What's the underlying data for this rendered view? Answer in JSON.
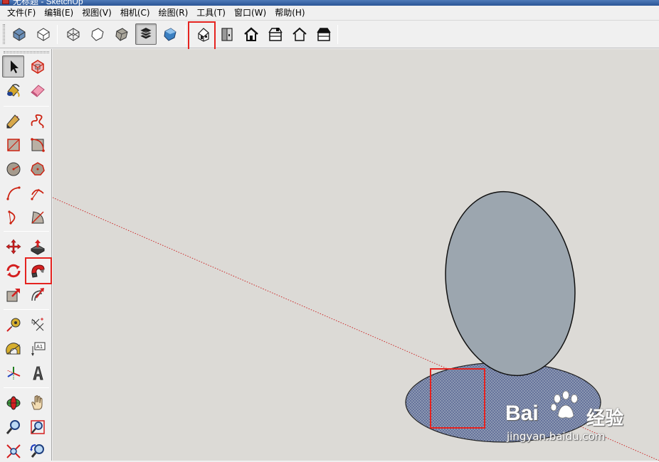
{
  "window": {
    "title": "无标题 - SketchUp"
  },
  "menubar": {
    "items": [
      "文件(F)",
      "编辑(E)",
      "视图(V)",
      "相机(C)",
      "绘图(R)",
      "工具(T)",
      "窗口(W)",
      "帮助(H)"
    ]
  },
  "toolbar": {
    "buttons": [
      "views-top-icon",
      "views-iso-icon",
      "style-xray-icon",
      "style-wireframe-icon",
      "style-hidden-line-icon",
      "style-shaded-icon",
      "style-shaded-textures-icon",
      "view-iso-house-icon",
      "view-top-house-icon",
      "view-front-house-icon",
      "view-right-house-icon",
      "view-back-house-icon",
      "view-left-house-icon"
    ],
    "highlighted": "view-iso-house-icon"
  },
  "left_toolbar": {
    "tools": [
      "select-icon",
      "make-component-icon",
      "paint-bucket-icon",
      "eraser-icon",
      "pencil-line-icon",
      "freehand-icon",
      "rectangle-icon",
      "rotated-rectangle-icon",
      "circle-icon",
      "polygon-icon",
      "arc-icon",
      "two-point-arc-icon",
      "three-point-arc-icon",
      "pie-icon",
      "move-icon",
      "push-pull-icon",
      "rotate-icon",
      "follow-me-icon",
      "scale-icon",
      "offset-icon",
      "tape-measure-icon",
      "dimension-icon",
      "protractor-icon",
      "text-icon",
      "axes-icon",
      "3d-text-icon",
      "orbit-icon",
      "pan-icon",
      "zoom-icon",
      "zoom-window-icon",
      "zoom-extents-icon",
      "previous-view-icon"
    ],
    "highlighted": "follow-me-icon",
    "text_tool_label": "A1"
  },
  "viewport": {
    "background": "#dcdad6",
    "ellipse_fill": "#9ca6af",
    "disc_fill": "#8c98b2",
    "axis_color": "#cc2a2a",
    "highlight_color": "#e5231f"
  },
  "watermark": {
    "brand": "Bai",
    "cn": "经验",
    "url": "jingyan.baidu.com"
  }
}
